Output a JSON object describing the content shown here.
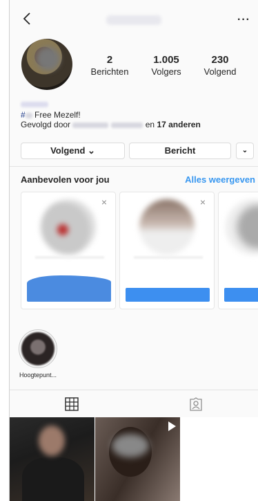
{
  "header": {
    "back_icon": "chevron-left-icon",
    "more_label": "···"
  },
  "profile": {
    "stats": [
      {
        "value": "2",
        "label": "Berichten"
      },
      {
        "value": "1.005",
        "label": "Volgers"
      },
      {
        "value": "230",
        "label": "Volgend"
      }
    ],
    "bio_hash": "#",
    "bio_text": "Free Mezelf!",
    "followed_by_prefix": "Gevolgd door",
    "followed_by_suffix": "en",
    "followed_by_count": "17 anderen"
  },
  "buttons": {
    "follow_label": "Volgend",
    "follow_chevron": "⌄",
    "message_label": "Bericht",
    "more_chevron": "⌄"
  },
  "suggestions": {
    "title": "Aanbevolen voor jou",
    "see_all": "Alles weergeven",
    "close_glyph": "×"
  },
  "highlights": [
    {
      "label": "Hoogtepunt..."
    }
  ],
  "tabs": [
    {
      "icon": "grid-icon"
    },
    {
      "icon": "tagged-icon"
    }
  ],
  "colors": {
    "link": "#3897f0",
    "button_blue": "#3d8ff0"
  }
}
